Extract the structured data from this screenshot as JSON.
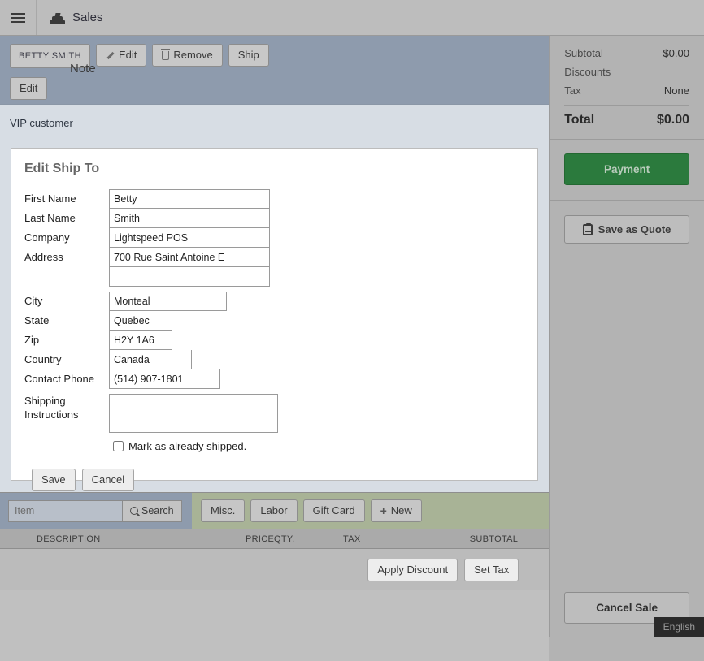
{
  "topbar": {
    "menu_icon": "hamburger-icon",
    "app_icon": "cash-register-icon",
    "title": "Sales"
  },
  "customer_bar": {
    "customer_name": "BETTY SMITH",
    "edit_label": "Edit",
    "remove_label": "Remove",
    "ship_label": "Ship",
    "note_heading": "Note",
    "note_edit_label": "Edit"
  },
  "vip_banner": {
    "text": "VIP customer"
  },
  "modal": {
    "title": "Edit Ship To",
    "fields": [
      {
        "label": "First Name",
        "value": "Betty"
      },
      {
        "label": "Last Name",
        "value": "Smith"
      },
      {
        "label": "Company",
        "value": "Lightspeed POS"
      },
      {
        "label": "Address",
        "value": "700 Rue Saint Antoine E"
      },
      {
        "label": "",
        "value": ""
      },
      {
        "label": "City",
        "value": "Monteal"
      },
      {
        "label": "State",
        "value": "Quebec"
      },
      {
        "label": "Zip",
        "value": "H2Y 1A6"
      },
      {
        "label": "Country",
        "value": "Canada"
      },
      {
        "label": "Contact Phone",
        "value": "(514) 907-1801"
      }
    ],
    "shipping_instructions_label": "Shipping Instructions",
    "shipping_instructions_value": "",
    "checkbox_label": "Mark as already shipped.",
    "checkbox_checked": false,
    "save_label": "Save",
    "cancel_label": "Cancel"
  },
  "item_bar": {
    "search_placeholder": "Item",
    "search_value": "",
    "search_button": "Search",
    "quick_buttons": [
      "Misc.",
      "Labor",
      "Gift Card",
      "+ New"
    ],
    "misc_label": "Misc.",
    "labor_label": "Labor",
    "gift_card_label": "Gift Card",
    "new_label": "New"
  },
  "items_table": {
    "columns": {
      "description": "DESCRIPTION",
      "price": "PRICE",
      "qty": "QTY.",
      "tax": "TAX",
      "subtotal": "SUBTOTAL"
    },
    "rows": [],
    "apply_discount_label": "Apply Discount",
    "set_tax_label": "Set Tax"
  },
  "sidebar": {
    "subtotal_label": "Subtotal",
    "subtotal_value": "$0.00",
    "discounts_label": "Discounts",
    "discounts_value": "",
    "tax_label": "Tax",
    "tax_value": "None",
    "total_label": "Total",
    "total_value": "$0.00",
    "payment_label": "Payment",
    "save_quote_label": "Save as Quote",
    "cancel_sale_label": "Cancel Sale"
  },
  "lang_badge": {
    "label": "English"
  },
  "colors": {
    "payment_green": "#2b7a3d",
    "item_bar_green": "#a8b396",
    "customer_bar_blue": "#8e9bad",
    "vip_band": "#d7dde4"
  }
}
